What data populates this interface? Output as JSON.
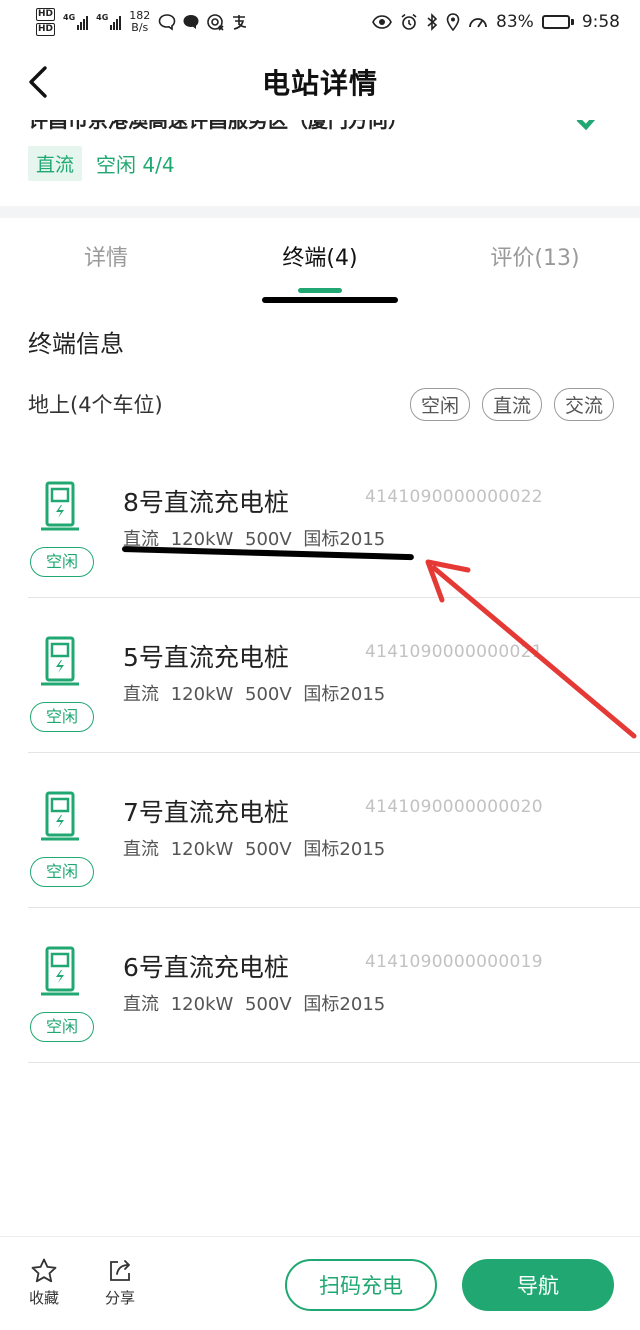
{
  "status_bar": {
    "hd1": "HD",
    "hd2": "HD",
    "net1": "4G",
    "net2": "4G",
    "speed_value": "182",
    "speed_unit": "B/s",
    "battery": "83%",
    "time": "9:58",
    "battery_level": 0.83
  },
  "header": {
    "title": "电站详情"
  },
  "station": {
    "name": "许昌市京港澳高速许昌服务区（厦门方向）",
    "dc_tag": "直流",
    "status": "空闲 4/4"
  },
  "tabs": [
    {
      "label": "详情"
    },
    {
      "label": "终端(4)"
    },
    {
      "label": "评价(13)"
    }
  ],
  "terminal_section": {
    "title": "终端信息",
    "ground_label": "地上(4个车位)",
    "filters": [
      "空闲",
      "直流",
      "交流"
    ]
  },
  "terminals": [
    {
      "name": "8号直流充电桩",
      "id": "4141090000000022",
      "spec": "直流 120kW 500V 国标2015",
      "status": "空闲"
    },
    {
      "name": "5号直流充电桩",
      "id": "4141090000000021",
      "spec": "直流 120kW 500V 国标2015",
      "status": "空闲"
    },
    {
      "name": "7号直流充电桩",
      "id": "4141090000000020",
      "spec": "直流 120kW 500V 国标2015",
      "status": "空闲"
    },
    {
      "name": "6号直流充电桩",
      "id": "4141090000000019",
      "spec": "直流 120kW 500V 国标2015",
      "status": "空闲"
    }
  ],
  "bottom_bar": {
    "favorite_label": "收藏",
    "share_label": "分享",
    "scan_label": "扫码充电",
    "navigate_label": "导航"
  },
  "colors": {
    "accent": "#21a872",
    "accent_light": "#e6f5ee",
    "annotation_red": "#e53935"
  }
}
